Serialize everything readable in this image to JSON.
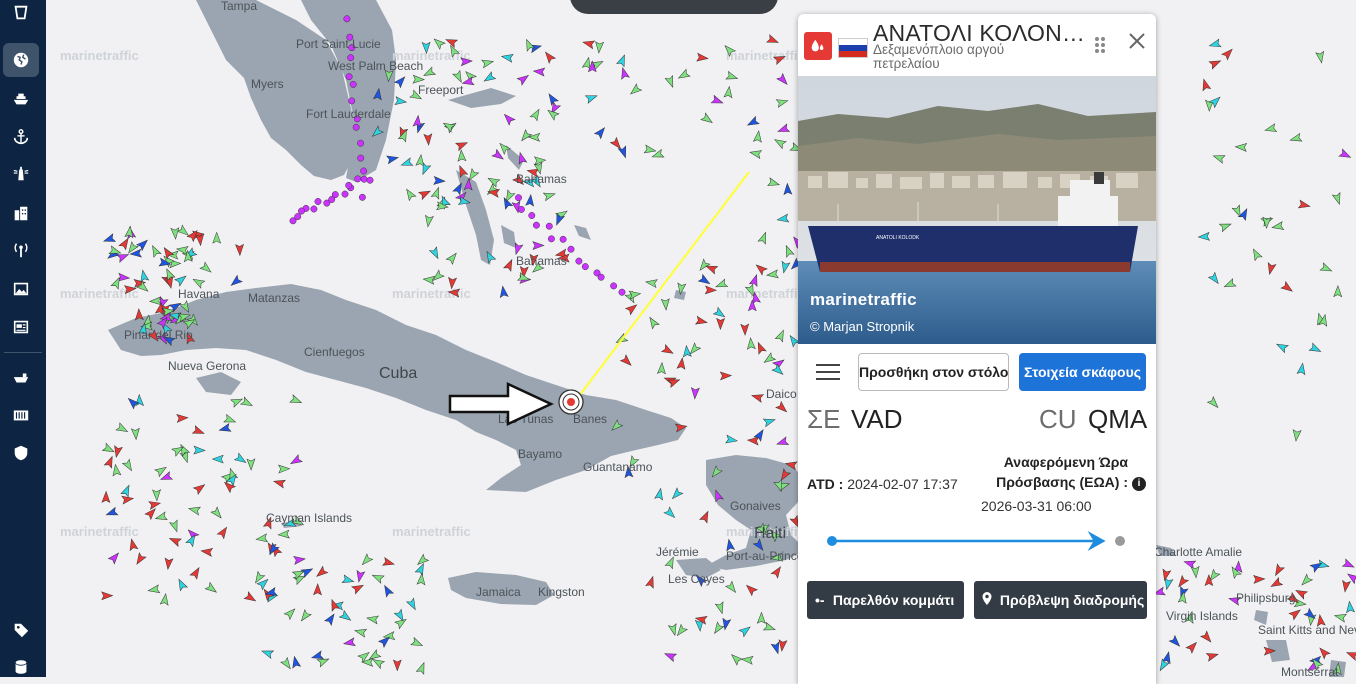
{
  "map": {
    "places": [
      {
        "name": "Tampa"
      },
      {
        "name": "Port Saint Lucie"
      },
      {
        "name": "West Palm Beach"
      },
      {
        "name": "Myers"
      },
      {
        "name": "Fort Lauderdale"
      },
      {
        "name": "Freeport"
      },
      {
        "name": "Bahamas"
      },
      {
        "name": "Bahamas"
      },
      {
        "name": "Havana"
      },
      {
        "name": "Matanzas"
      },
      {
        "name": "Pinar del Rio"
      },
      {
        "name": "Cienfuegos"
      },
      {
        "name": "Nueva Gerona"
      },
      {
        "name": "Cuba"
      },
      {
        "name": "Las Tunas"
      },
      {
        "name": "Banes"
      },
      {
        "name": "Bayamo"
      },
      {
        "name": "Guantanamo"
      },
      {
        "name": "Cayman Islands"
      },
      {
        "name": "Jamaica"
      },
      {
        "name": "Kingston"
      },
      {
        "name": "Gonaives"
      },
      {
        "name": "Haiti"
      },
      {
        "name": "Jérémie"
      },
      {
        "name": "Port-au-Prince"
      },
      {
        "name": "Les Cayes"
      },
      {
        "name": "Charlotte Amalie"
      },
      {
        "name": "Virgin Islands"
      },
      {
        "name": "Philipsburg"
      },
      {
        "name": "Saint Kitts and Nevis"
      },
      {
        "name": "Montserrat"
      },
      {
        "name": "Daico"
      }
    ],
    "watermark": "marinetraffic"
  },
  "rail": {
    "items": [
      {
        "name": "globe-icon",
        "active": true
      },
      {
        "name": "ship-icon",
        "active": false
      },
      {
        "name": "anchor-icon",
        "active": false
      },
      {
        "name": "lighthouse-icon",
        "active": false
      },
      {
        "name": "building-icon",
        "active": false
      },
      {
        "name": "antenna-icon",
        "active": false
      },
      {
        "name": "image-gallery-icon",
        "active": false
      },
      {
        "name": "news-icon",
        "active": false
      },
      {
        "name": "cargo-ship-icon",
        "active": false
      },
      {
        "name": "container-icon",
        "active": false
      },
      {
        "name": "shield-icon",
        "active": false
      },
      {
        "name": "tag-icon",
        "active": false
      },
      {
        "name": "database-icon",
        "active": false
      }
    ]
  },
  "vessel": {
    "name": "ΑΝΑΤΟΛΙ ΚΟΛΟΝ…",
    "type": "Δεξαμενόπλοιο αργού πετρελαίου",
    "photo_logo": "marinetraffic",
    "photo_credit": "© Marjan Stropnik",
    "hull_text": "ANATOLI KOLODK",
    "flag_colors": [
      "#ffffff",
      "#1c3fae",
      "#d52b1e"
    ]
  },
  "actions": {
    "fleet_label": "Προσθήκη στον στόλο",
    "details_label": "Στοιχεία σκάφους"
  },
  "voyage": {
    "departure_country": "ΣΕ",
    "departure_port": "VAD",
    "arrival_country": "CU",
    "arrival_port": "QMA",
    "atd_label": "ATD :",
    "atd_value": "2024-02-07 17:37",
    "eta_label": "Αναφερόμενη Ώρα Πρόσβασης (ΕΩΑ) :",
    "eta_value": "2026-03-31 06:00",
    "progress": 0.95
  },
  "buttons": {
    "past_track": "Παρελθόν κομμάτι",
    "route_forecast": "Πρόβλεψη διαδρομής"
  },
  "colors": {
    "rail_bg": "#0d2542",
    "accent_blue": "#1e73d8",
    "track_yellow": "#ffff33",
    "tanker_red": "#e53935",
    "cargo_green": "#7ee07e",
    "passenger_blue": "#1f55e0",
    "pleasure_magenta": "#cc33ff",
    "tug_cyan": "#2fd3e0"
  }
}
